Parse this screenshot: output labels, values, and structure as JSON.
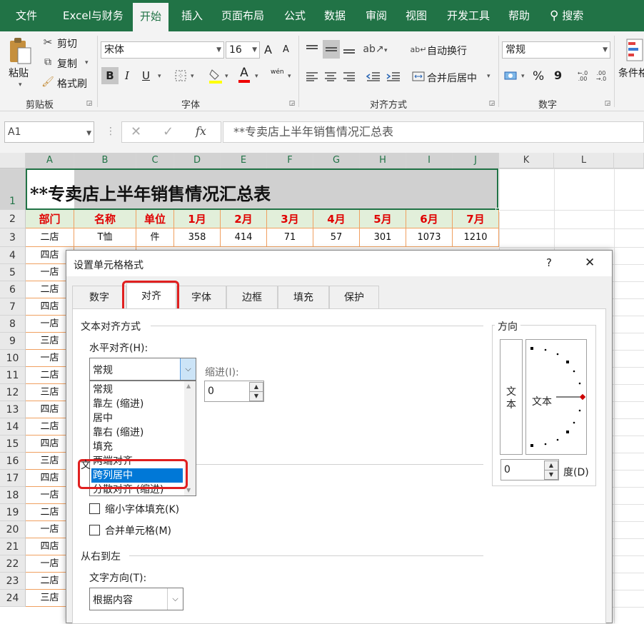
{
  "menu": {
    "tabs": [
      "文件",
      "Excel与财务",
      "开始",
      "插入",
      "页面布局",
      "公式",
      "数据",
      "审阅",
      "视图",
      "开发工具",
      "帮助"
    ],
    "search": "搜索"
  },
  "ribbon": {
    "clipboard": {
      "paste": "粘贴",
      "cut": "剪切",
      "copy": "复制",
      "format_painter": "格式刷",
      "group": "剪贴板"
    },
    "font": {
      "name": "宋体",
      "size": "16",
      "group": "字体",
      "bold": "B",
      "italic": "I",
      "underline": "U",
      "grow": "A",
      "shrink": "A",
      "color_a": "A",
      "wen": "wén"
    },
    "alignment": {
      "wrap": "自动换行",
      "merge": "合并后居中",
      "group": "对齐方式"
    },
    "number": {
      "format": "常规",
      "percent": "%",
      "comma": "9",
      "group": "数字",
      "inc_dec": ".0\n.00",
      "dec_dec": ".00\n.0"
    },
    "styles": {
      "conditional": "条件格"
    }
  },
  "formula_bar": {
    "name_box": "A1",
    "fx": "fx",
    "content": "**专卖店上半年销售情况汇总表"
  },
  "sheet": {
    "columns": [
      "A",
      "B",
      "C",
      "D",
      "E",
      "F",
      "G",
      "H",
      "I",
      "J",
      "K",
      "L"
    ],
    "rows": [
      "1",
      "2",
      "3",
      "4",
      "5",
      "6",
      "7",
      "8",
      "9",
      "10",
      "11",
      "12",
      "13",
      "14",
      "15",
      "16",
      "17",
      "18",
      "19",
      "20",
      "21",
      "22",
      "23",
      "24"
    ],
    "title": "**专卖店上半年销售情况汇总表",
    "headers": [
      "部门",
      "名称",
      "单位",
      "1月",
      "2月",
      "3月",
      "4月",
      "5月",
      "6月",
      "7月"
    ],
    "row3": [
      "二店",
      "T恤",
      "件",
      "358",
      "414",
      "71",
      "57",
      "301",
      "1073",
      "1210"
    ],
    "col_a": [
      "四店",
      "一店",
      "二店",
      "四店",
      "一店",
      "三店",
      "一店",
      "二店",
      "三店",
      "四店",
      "二店",
      "四店",
      "三店",
      "四店",
      "一店",
      "二店",
      "一店",
      "四店",
      "一店",
      "二店",
      "三店"
    ]
  },
  "dialog": {
    "title": "设置单元格格式",
    "help": "?",
    "close": "✕",
    "tabs": [
      "数字",
      "对齐",
      "字体",
      "边框",
      "填充",
      "保护"
    ],
    "text_align_section": "文本对齐方式",
    "horizontal_label": "水平对齐(H):",
    "horizontal_value": "常规",
    "horizontal_options": [
      "常规",
      "靠左 (缩进)",
      "居中",
      "靠右 (缩进)",
      "填充",
      "两端对齐",
      "跨列居中",
      "分散对齐 (缩进)"
    ],
    "selected_option": "跨列居中",
    "indent_label": "缩进(I):",
    "indent_value": "0",
    "text_control_partial": "文",
    "shrink_label": "缩小字体填充(K)",
    "merge_label": "合并单元格(M)",
    "rtl_section": "从右到左",
    "text_direction_label": "文字方向(T):",
    "text_direction_value": "根据内容",
    "orientation_section": "方向",
    "vertical_text": "文本",
    "rotated_text": "文本",
    "degree_value": "0",
    "degree_label": "度(D)"
  }
}
